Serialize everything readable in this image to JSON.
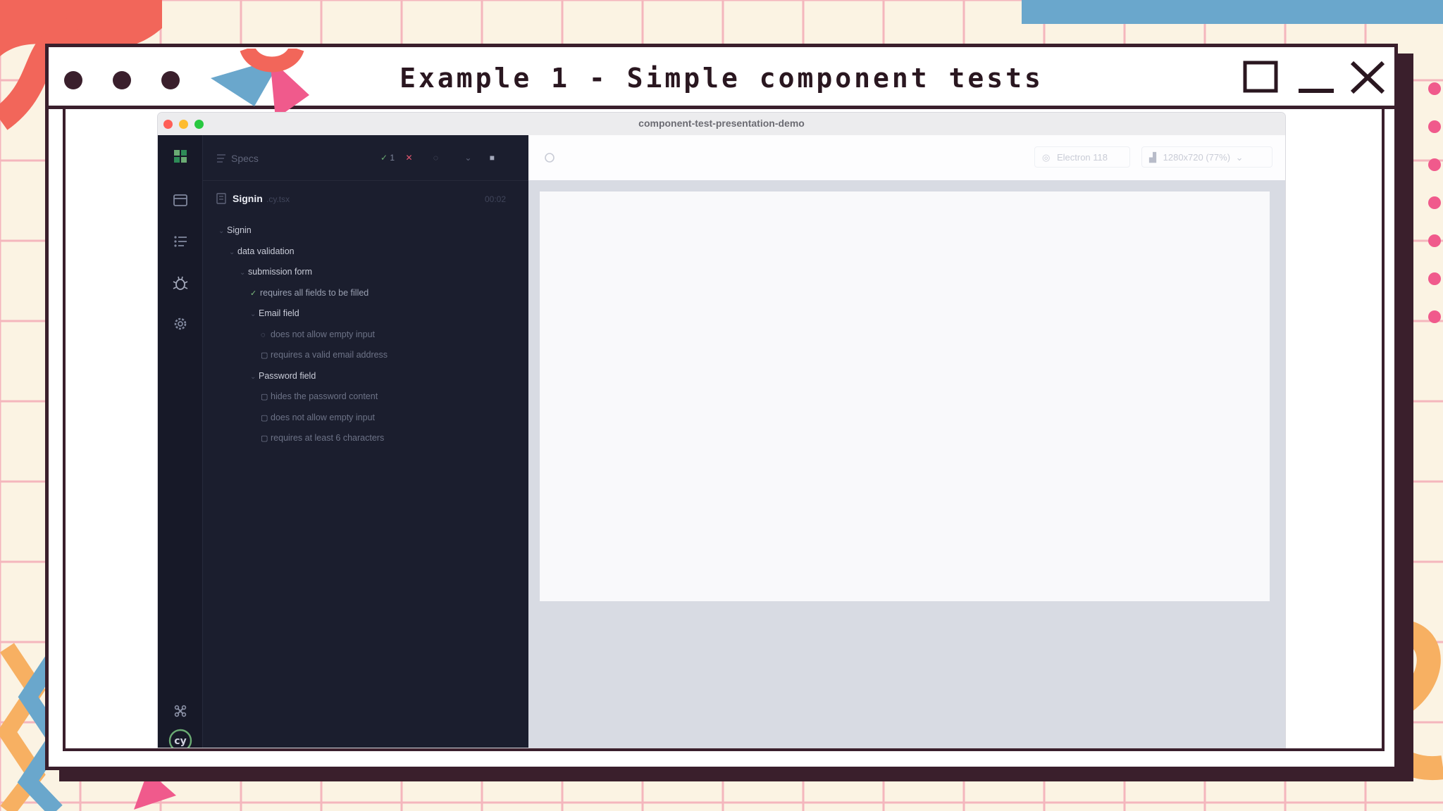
{
  "presentation": {
    "title": "Example 1 - Simple component tests"
  },
  "app": {
    "window_title": "component-test-presentation-demo",
    "reporter": {
      "specs_label": "Specs",
      "passed_count": "1",
      "spec_file": "Signin",
      "spec_ext": ".cy.tsx",
      "duration": "00:02",
      "tree": [
        {
          "label": "Signin",
          "kind": "suite",
          "depth": 0
        },
        {
          "label": "data validation",
          "kind": "suite",
          "depth": 1
        },
        {
          "label": "submission form",
          "kind": "suite",
          "depth": 2
        },
        {
          "label": "requires all fields to be filled",
          "kind": "test",
          "status": "passed",
          "depth": 3
        },
        {
          "label": "Email field",
          "kind": "suite",
          "depth": 3
        },
        {
          "label": "does not allow empty input",
          "kind": "test",
          "status": "running",
          "depth": 4
        },
        {
          "label": "requires a valid email address",
          "kind": "test",
          "status": "pending",
          "depth": 4
        },
        {
          "label": "Password field",
          "kind": "suite",
          "depth": 3
        },
        {
          "label": "hides the password content",
          "kind": "test",
          "status": "pending",
          "depth": 4
        },
        {
          "label": "does not allow empty input",
          "kind": "test",
          "status": "pending",
          "depth": 4
        },
        {
          "label": "requires at least 6 characters",
          "kind": "test",
          "status": "pending",
          "depth": 4
        }
      ]
    },
    "preview": {
      "browser": "Electron 118",
      "viewport": "1280x720 (77%)"
    }
  },
  "icons": {
    "sidebar": [
      "cypress-logo-icon",
      "runs-icon",
      "specs-list-icon",
      "debug-icon",
      "settings-icon",
      "keyboard-shortcut-icon",
      "cy-logo-icon"
    ]
  },
  "colors": {
    "frame": "#3a1f2c",
    "reporter_bg": "#1b1e2e",
    "iconbar_bg": "#171928",
    "accent_green": "#6aab73",
    "fail_red": "#e45770"
  }
}
